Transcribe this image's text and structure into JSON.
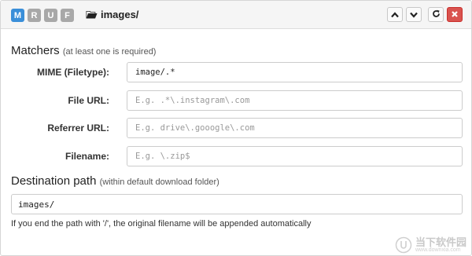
{
  "header": {
    "badges": [
      {
        "label": "M",
        "active": true
      },
      {
        "label": "R",
        "active": false
      },
      {
        "label": "U",
        "active": false
      },
      {
        "label": "F",
        "active": false
      }
    ],
    "title": "images/",
    "buttons": [
      "move-up-icon",
      "move-down-icon",
      "reload-icon",
      "close-icon"
    ]
  },
  "matchers": {
    "title": "Matchers",
    "hint": "(at least one is required)",
    "rows": [
      {
        "label": "MIME (Filetype):",
        "value": "image/.*",
        "placeholder": ""
      },
      {
        "label": "File URL:",
        "value": "",
        "placeholder": "E.g. .*\\.instagram\\.com"
      },
      {
        "label": "Referrer URL:",
        "value": "",
        "placeholder": "E.g. drive\\.gooogle\\.com"
      },
      {
        "label": "Filename:",
        "value": "",
        "placeholder": "E.g. \\.zip$"
      }
    ]
  },
  "destination": {
    "title": "Destination path",
    "hint": "(within default download folder)",
    "value": "images/",
    "help": "If you end the path with '/', the original filename will be appended automatically"
  },
  "watermark": {
    "main": "当下软件园",
    "sub": "www.downxia.com"
  },
  "colors": {
    "active_badge": "#3a8fd9",
    "inactive_badge": "#a8a8a8",
    "danger": "#d9534f"
  }
}
